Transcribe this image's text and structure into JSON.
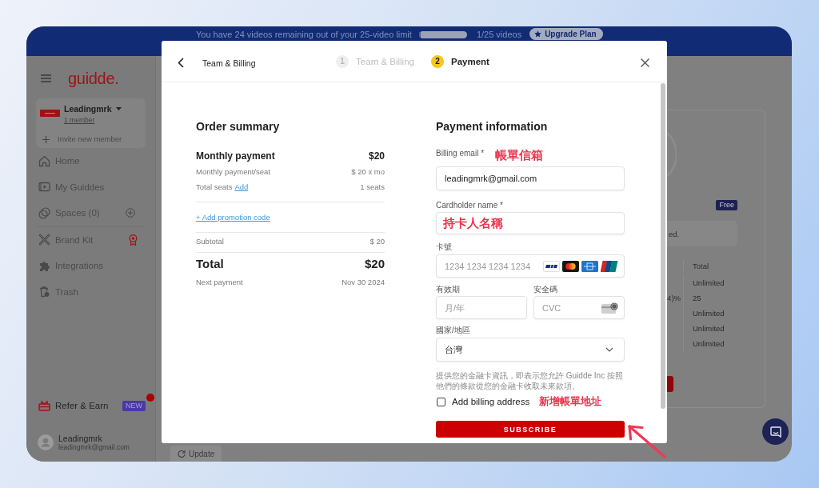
{
  "banner": {
    "message": "You have 24 videos remaining out of your 25-video limit",
    "level": 0.04,
    "usage": "1/25 videos",
    "upgrade_button": "Upgrade Plan"
  },
  "sidebar": {
    "logo": "guidde.",
    "workspace": {
      "name": "Leadingmrk",
      "members": "1 member",
      "invite": "Invite new member"
    },
    "nav_groups": [
      {
        "items": [
          {
            "label": "Home",
            "kind": "link"
          },
          {
            "label": "My Guiddes",
            "kind": "link"
          },
          {
            "label": "Spaces (0)",
            "kind": "add"
          }
        ]
      },
      {
        "items": [
          {
            "label": "Brand Kit",
            "kind": "premium"
          },
          {
            "label": "Integrations",
            "kind": "link"
          },
          {
            "label": "Trash",
            "kind": "link"
          }
        ]
      }
    ],
    "refer": {
      "label": "Refer & Earn",
      "badge": "NEW"
    },
    "user": {
      "name": "Leadingmrk",
      "email": "leadingmrk@gmail.com"
    }
  },
  "plan_card": {
    "badge": "Free",
    "notice_fragment": "ed.",
    "table": {
      "total_header": "Total",
      "rows": [
        {
          "total": "Unlimited"
        },
        {
          "column_1": "4)%",
          "total": "25"
        },
        {
          "total": "Unlimited"
        },
        {
          "total": "Unlimited"
        },
        {
          "total": "Unlimited"
        }
      ]
    }
  },
  "update_button": "Update",
  "modal": {
    "back_label": "Team & Billing",
    "steps": [
      {
        "number": "1",
        "label": "Team & Billing",
        "selected": false
      },
      {
        "number": "2",
        "label": "Payment",
        "selected": true
      }
    ],
    "order_summary": {
      "title": "Order summary",
      "plan": {
        "label": "Monthly payment",
        "amount": "$20"
      },
      "rows": [
        {
          "label": "Monthly payment/seat",
          "value": "$ 20 x mo"
        },
        {
          "label": "Total seats",
          "link": "Add",
          "value": "1 seats"
        }
      ],
      "promo_link": "+ Add promotion code",
      "subtotal": {
        "label": "Subtotal",
        "value": "$ 20"
      },
      "total": {
        "label": "Total",
        "amount": "$20"
      },
      "next_payment": {
        "label": "Next payment",
        "value": "Nov 30 2024"
      }
    },
    "payment": {
      "title": "Payment information",
      "email": {
        "label": "Billing email *",
        "annotation": "帳單信箱",
        "value": "leadingmrk@gmail.com"
      },
      "cardholder": {
        "label": "Cardholder name *",
        "annotation": "持卡人名稱"
      },
      "card_number": {
        "label": "卡號",
        "placeholder": "1234 1234 1234 1234"
      },
      "expiry": {
        "label": "有效期",
        "placeholder": "月/年"
      },
      "cvc": {
        "label": "安全碼",
        "placeholder": "CVC"
      },
      "country": {
        "label": "國家/地區",
        "value": "台灣"
      },
      "consent": "提供您的金融卡資訊，即表示您允許 Guidde Inc 按照他們的條款從您的金融卡收取未來款項。",
      "billing_address": {
        "label": "Add billing address",
        "checked": false,
        "annotation": "新增帳單地址"
      },
      "subscribe_button": "SUBSCRIBE"
    }
  }
}
